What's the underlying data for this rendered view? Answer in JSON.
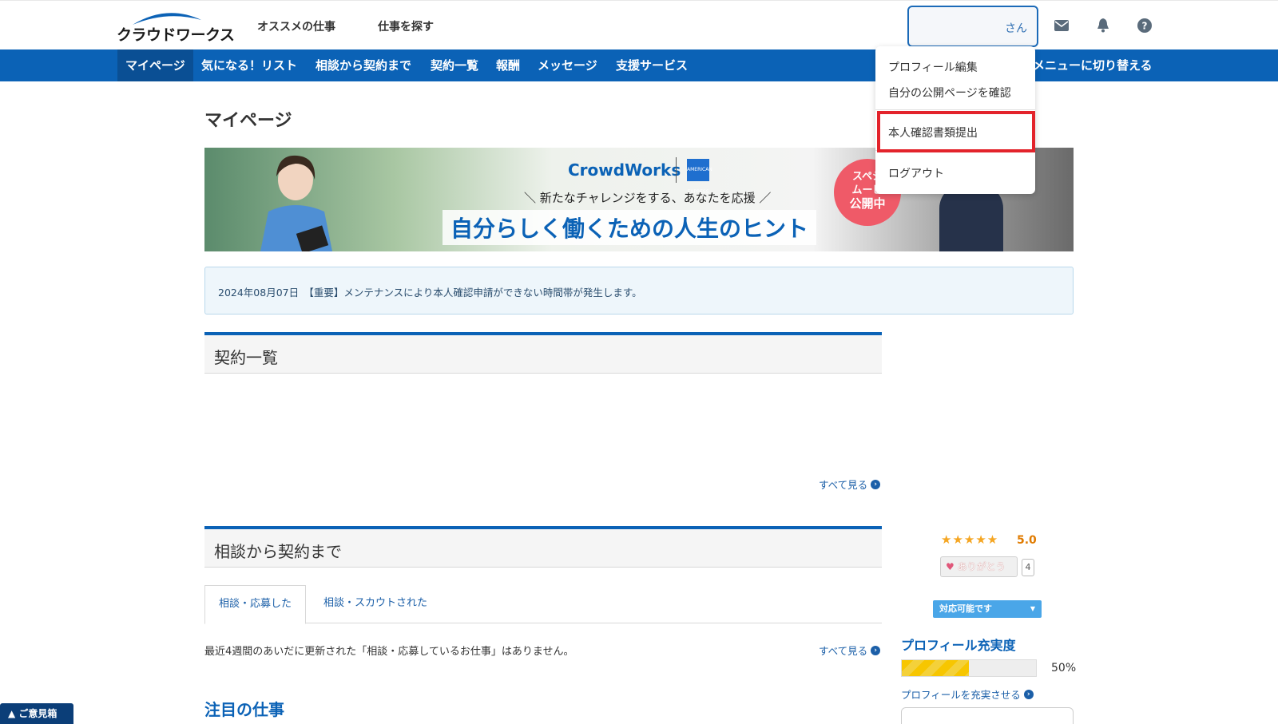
{
  "header": {
    "logo_text": "クラウドワークス",
    "nav": [
      "オススメの仕事",
      "仕事を探す"
    ],
    "user_suffix": "さん"
  },
  "navbar": {
    "items": [
      "マイページ",
      "気になる！リスト",
      "相談から契約まで",
      "契約一覧",
      "報酬",
      "メッセージ",
      "支援サービス"
    ],
    "right_text": "メニューに切り替える"
  },
  "dropdown": {
    "items": [
      "プロフィール編集",
      "自分の公開ページを確認",
      "本人確認書類提出",
      "ログアウト"
    ]
  },
  "page": {
    "title": "マイページ"
  },
  "banner": {
    "brand": "CrowdWorks",
    "partner_mark": "AMERICAN EXPRESS",
    "subcopy": "＼ 新たなチャレンジをする、あなたを応援 ／",
    "headline": "自分らしく働くための人生のヒント",
    "badge_lines": [
      "スペシ",
      "ムービ",
      "公開中"
    ]
  },
  "notice": {
    "text": "2024年08月07日　【重要】メンテナンスにより本人確認申請ができない時間帯が発生します。"
  },
  "sections": {
    "contracts": {
      "title": "契約一覧",
      "see_all": "すべて見る"
    },
    "consultation": {
      "title": "相談から契約まで",
      "tabs": [
        "相談・応募した",
        "相談・スカウトされた"
      ],
      "empty_message": "最近4週間のあいだに更新された「相談・応募しているお仕事」はありません。",
      "see_all": "すべて見る"
    },
    "featured": {
      "title": "注目の仕事"
    }
  },
  "sidebar": {
    "stars": "★★★★★",
    "rating": "5.0",
    "thanks_label": "ありがとう",
    "thanks_count": "4",
    "availability": "対応可能です",
    "profile_title": "プロフィール充実度",
    "profile_percent": 50,
    "profile_percent_label": "50%",
    "profile_link": "プロフィールを充実させる"
  },
  "feedback": {
    "label": "▲ ご意見箱"
  },
  "colors": {
    "brand_blue": "#0b62b6",
    "highlight_red": "#e3232b",
    "star": "#f5a623"
  }
}
